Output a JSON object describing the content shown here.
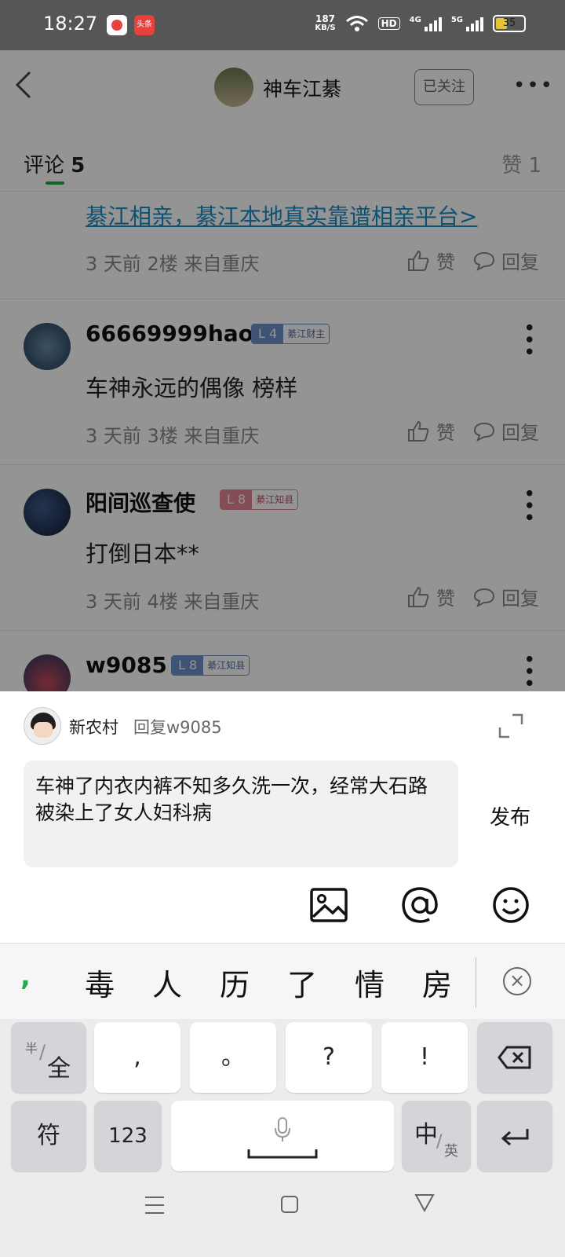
{
  "status_bar": {
    "time": "18:27",
    "app2_label": "头条",
    "net_speed_value": "187",
    "net_speed_unit": "KB/S",
    "hd": "HD",
    "signal1": "4G",
    "signal2": "5G",
    "battery": "35"
  },
  "header": {
    "author_name": "神车江綦",
    "follow_label": "已关注"
  },
  "tabs": {
    "comments_label": "评论",
    "comments_count": "5",
    "likes_label": "赞 1"
  },
  "comments": [
    {
      "link": "綦江相亲，綦江本地真实靠谱相亲平台>",
      "meta": "3 天前  2楼  来自重庆",
      "like": "赞",
      "reply": "回复"
    },
    {
      "name": "66669999hao",
      "level": "L 4",
      "title": "綦江财主",
      "text": "车神永远的偶像 榜样",
      "meta": "3 天前  3楼  来自重庆",
      "like": "赞",
      "reply": "回复"
    },
    {
      "name": "阳间巡查使",
      "level": "L 8",
      "title": "綦江知县",
      "text": "打倒日本**",
      "meta": "3 天前  4楼  来自重庆",
      "like": "赞",
      "reply": "回复"
    },
    {
      "name": "w9085",
      "level": "L 8",
      "title": "綦江知县"
    }
  ],
  "reply_sheet": {
    "user_name": "新农村",
    "reply_to": "回复w9085",
    "input_text": "车神了内衣内裤不知多久洗一次，经常大石路被染上了女人妇科病",
    "publish_label": "发布"
  },
  "keyboard": {
    "candidate_punct": ",",
    "candidates": [
      "毒",
      "人",
      "历",
      "了",
      "情",
      "房"
    ],
    "half_full_top": "半",
    "half_full_main": "全",
    "row1": [
      ",",
      "。",
      "?",
      "!"
    ],
    "symbols": "符",
    "numbers": "123",
    "lang_main": "中",
    "lang_sub": "英"
  },
  "colors": {
    "accent_green": "#22a94a",
    "link_blue": "#1a8cc4"
  }
}
